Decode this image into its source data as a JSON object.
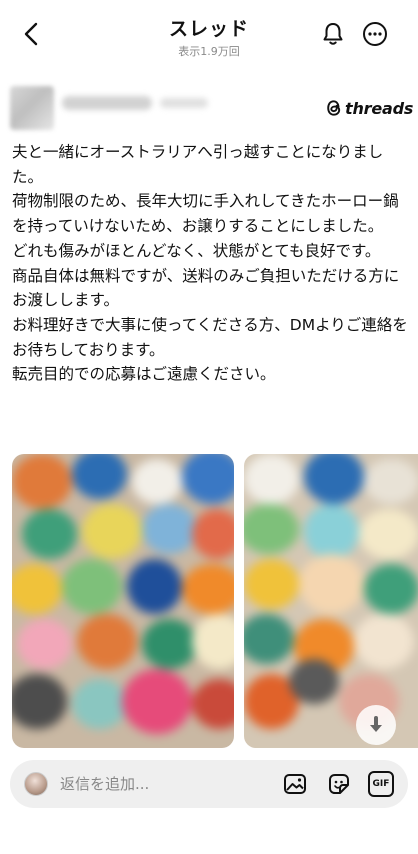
{
  "header": {
    "title": "スレッド",
    "subtitle": "表示1.9万回"
  },
  "post": {
    "brand": "threads",
    "lines": [
      "夫と一緒にオーストラリアへ引っ越すことになりました。",
      "荷物制限のため、長年大切に手入れしてきたホーロー鍋を持っていけないため、お譲りすることにしました。",
      "どれも傷みがほとんどなく、状態がとても良好です。",
      "商品自体は無料ですが、送料のみご負担いただける方にお渡しします。",
      "お料理好きで大事に使ってくださる方、DMよりご連絡をお待ちしております。",
      "転売目的での応募はご遠慮ください。"
    ]
  },
  "reply_bar": {
    "placeholder": "返信を追加...",
    "gif_label": "GIF"
  },
  "icons": {
    "back": "chevron-left-icon",
    "bell": "bell-icon",
    "more": "more-circle-icon",
    "brand": "threads-logo-icon",
    "image": "image-icon",
    "sticker": "sticker-icon",
    "gif": "gif-icon",
    "download": "download-icon"
  },
  "colors": {
    "text": "#111111",
    "muted": "#8a8a8a",
    "reply_bg": "#efefef"
  }
}
